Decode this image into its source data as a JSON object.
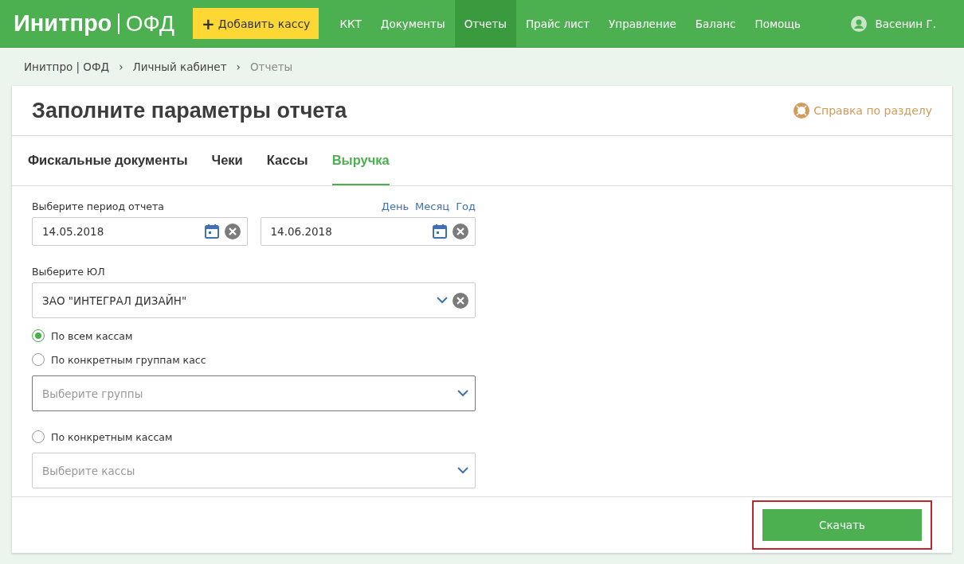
{
  "header": {
    "logo_brand": "Инитпро",
    "logo_product": "ОФД",
    "add_button": {
      "icon": "+",
      "label": "Добавить кассу"
    },
    "nav": [
      {
        "label": "ККТ",
        "selected": false
      },
      {
        "label": "Документы",
        "selected": false
      },
      {
        "label": "Отчеты",
        "selected": true
      },
      {
        "label": "Прайс лист",
        "selected": false
      },
      {
        "label": "Управление",
        "selected": false
      },
      {
        "label": "Баланс",
        "selected": false
      },
      {
        "label": "Помощь",
        "selected": false
      }
    ],
    "user": "Васенин Г."
  },
  "breadcrumbs": [
    {
      "label": "Инитпро | ОФД",
      "current": false
    },
    {
      "label": "Личный кабинет",
      "current": false
    },
    {
      "label": "Отчеты",
      "current": true
    }
  ],
  "breadcrumb_separator": "›",
  "card": {
    "title": "Заполните параметры отчета",
    "help_link": "Справка по разделу",
    "tabs": [
      {
        "label": "Фискальные документы",
        "selected": false
      },
      {
        "label": "Чеки",
        "selected": false
      },
      {
        "label": "Кассы",
        "selected": false
      },
      {
        "label": "Выручка",
        "selected": true
      }
    ],
    "period": {
      "label": "Выберите период отчета",
      "quick": [
        "День",
        "Месяц",
        "Год"
      ],
      "from": "14.05.2018",
      "to": "14.06.2018"
    },
    "entity": {
      "label": "Выберите ЮЛ",
      "value": "ЗАО \"ИНТЕГРАЛ ДИЗАЙН\""
    },
    "scope": [
      {
        "label": "По всем кассам",
        "selected": true
      },
      {
        "label": "По конкретным группам касс",
        "selected": false,
        "select": {
          "placeholder": "Выберите группы",
          "focused": true
        }
      },
      {
        "label": "По конкретным кассам",
        "selected": false,
        "select": {
          "placeholder": "Выберите кассы",
          "focused": false
        }
      }
    ],
    "download_button": {
      "label": "Скачать",
      "highlighted": true
    }
  }
}
